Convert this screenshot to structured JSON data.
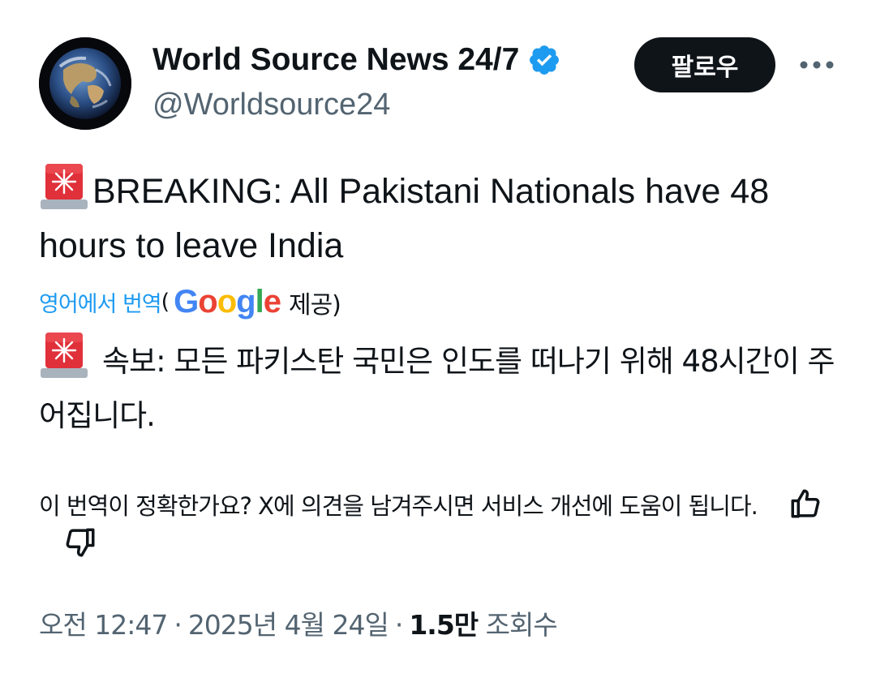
{
  "header": {
    "display_name": "World Source News 24/7",
    "handle": "@Worldsource24",
    "follow_label": "팔로우",
    "more_icon": "more-horizontal-icon",
    "verified_icon": "verified-badge-icon",
    "accent_color": "#1d9bf0",
    "follow_bg": "#0f1419"
  },
  "tweet": {
    "body_en": "BREAKING: All Pakistani Nationals have 48 hours to leave India",
    "siren_icon": "police-car-light-emoji",
    "translation": {
      "link_label": "영어에서 번역",
      "open_paren": "(",
      "provider": "Google",
      "provided_label": "제공)"
    },
    "body_ko": "속보: 모든 파키스탄 국민은 인도를 떠나기 위해 48시간이 주어집니다.",
    "feedback": {
      "text": "이 번역이 정확한가요? X에 의견을 남겨주시면 서비스 개선에 도움이 됩니다.",
      "like_icon": "thumbs-up-icon",
      "dislike_icon": "thumbs-down-icon"
    }
  },
  "meta": {
    "time": "오전 12:47",
    "separator": "·",
    "date": "2025년 4월 24일",
    "views_count": "1.5만",
    "views_label": "조회수"
  }
}
